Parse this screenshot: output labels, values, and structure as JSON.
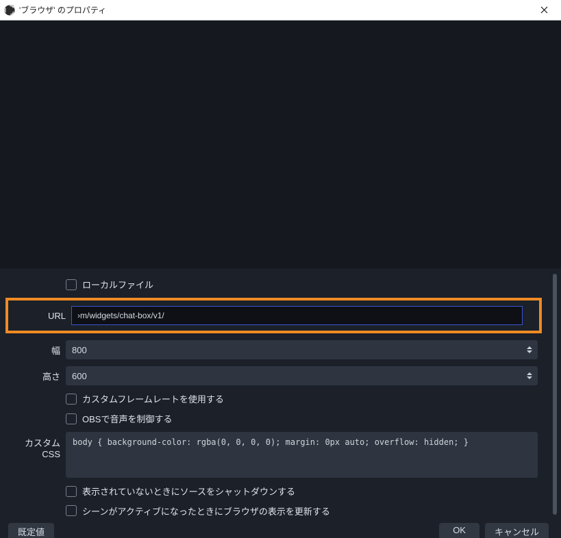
{
  "window": {
    "title": "'ブラウザ' のプロパティ"
  },
  "form": {
    "local_file_label": "ローカルファイル",
    "url_label": "URL",
    "url_value": "›m/widgets/chat-box/v1/",
    "width_label": "幅",
    "width_value": "800",
    "height_label": "高さ",
    "height_value": "600",
    "custom_fps_label": "カスタムフレームレートを使用する",
    "control_audio_label": "OBSで音声を制御する",
    "custom_css_label": "カスタム CSS",
    "custom_css_value": "body { background-color: rgba(0, 0, 0, 0); margin: 0px auto; overflow: hidden; }",
    "shutdown_label": "表示されていないときにソースをシャットダウンする",
    "refresh_active_label": "シーンがアクティブになったときにブラウザの表示を更新する"
  },
  "footer": {
    "defaults": "既定値",
    "ok": "OK",
    "cancel": "キャンセル"
  }
}
